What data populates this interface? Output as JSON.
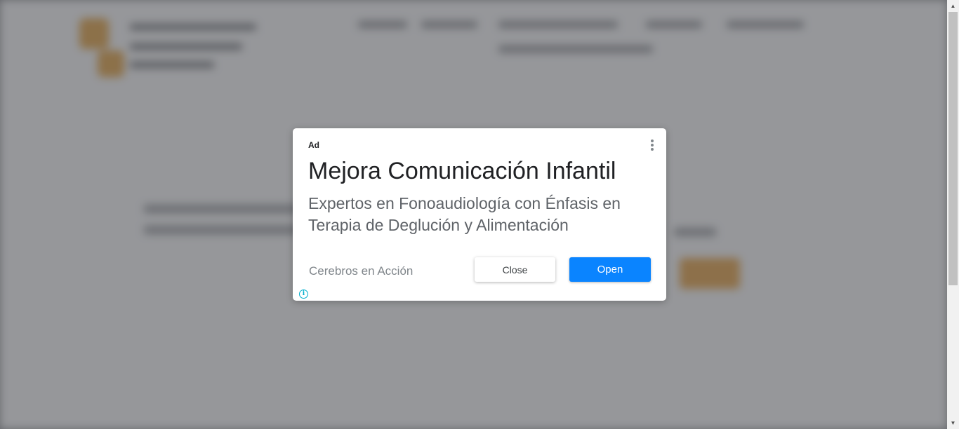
{
  "ad": {
    "label": "Ad",
    "title": "Mejora Comunicación Infantil",
    "description": "Expertos en Fonoaudiología con Énfasis en Terapia de Deglución y Alimentación",
    "advertiser": "Cerebros en Acción",
    "close_label": "Close",
    "open_label": "Open",
    "info_glyph": "i",
    "menu_icon": "more-vert-icon",
    "colors": {
      "open_button": "#0a84ff",
      "info_icon": "#00aecd",
      "overlay": "#8a8c8f"
    }
  },
  "scrollbar": {
    "up_glyph": "▲",
    "down_glyph": "▼"
  }
}
